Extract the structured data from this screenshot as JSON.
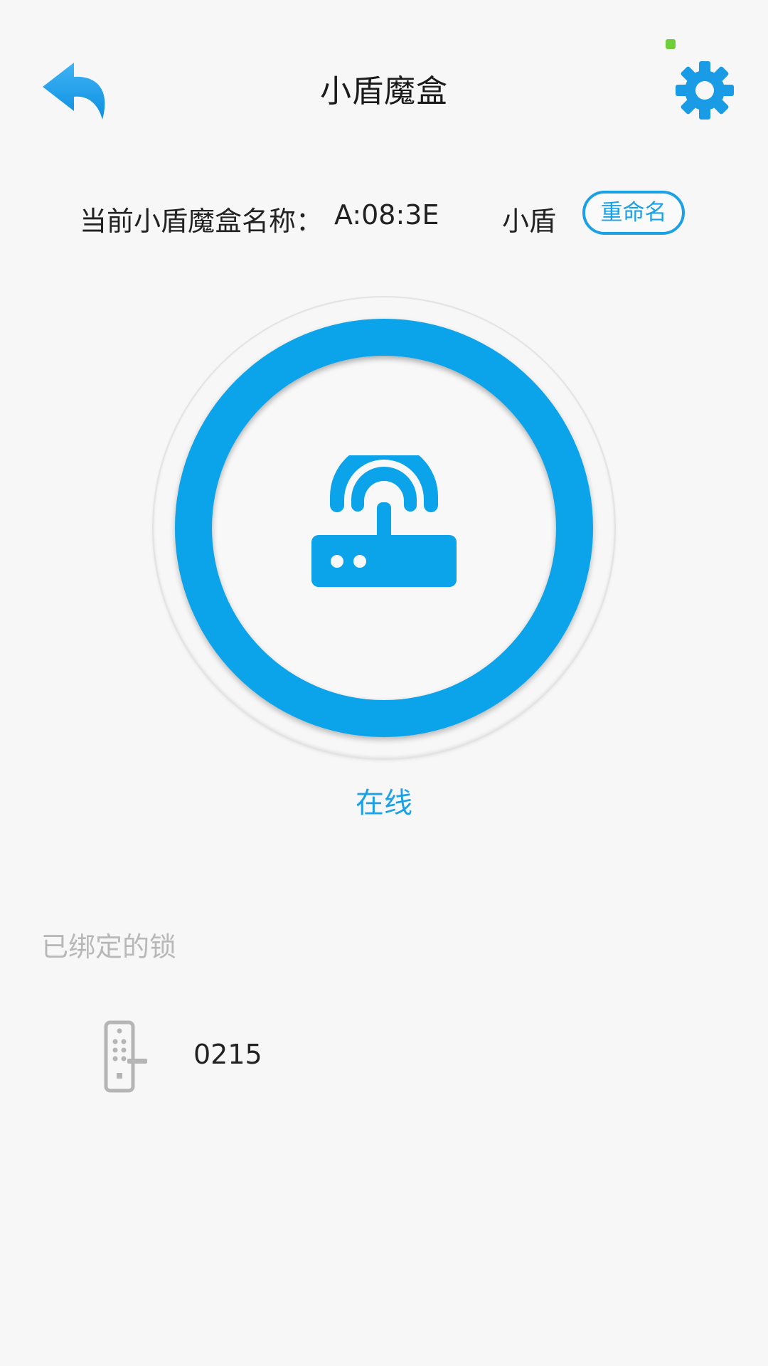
{
  "header": {
    "title": "小盾魔盒",
    "back_icon": "back-arrow-icon",
    "settings_icon": "gear-icon"
  },
  "device": {
    "name_label": "当前小盾魔盒名称：",
    "name_value": "A:08:3E",
    "alias": "小盾",
    "rename_label": "重命名"
  },
  "status": {
    "icon": "router-icon",
    "text": "在线"
  },
  "bound_locks": {
    "title": "已绑定的锁",
    "items": [
      {
        "icon": "door-lock-icon",
        "name": "0215"
      }
    ]
  },
  "colors": {
    "accent": "#0ba3ea",
    "status_indicator": "#6fcf3a",
    "muted_text": "#b8b8b8"
  }
}
